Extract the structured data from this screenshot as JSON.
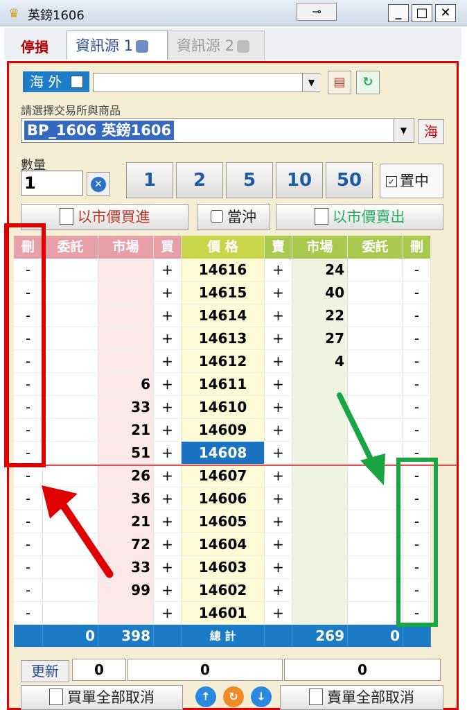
{
  "window": {
    "title": "英鎊1606",
    "min_glyph": "_",
    "max_glyph": "□",
    "close_glyph": "✕",
    "pin_glyph": "⊸"
  },
  "tabs": {
    "stop_loss": "停損",
    "source1": "資訊源 1",
    "source2": "資訊源 2"
  },
  "top": {
    "overseas_label": "海 外",
    "exchange_label": "請選擇交易所與商品",
    "exchange_value": "BP_1606 英鎊1606",
    "hai_button": "海"
  },
  "quantity": {
    "label": "數量",
    "value": "1",
    "presets": [
      "1",
      "2",
      "5",
      "10",
      "50"
    ],
    "center_label": "置中",
    "center_checked": true
  },
  "orders": {
    "buy_market": "以市價買進",
    "day_trade": "當沖",
    "sell_market": "以市價賣出"
  },
  "book": {
    "headers": [
      "刪",
      "委託",
      "市場",
      "買",
      "價 格",
      "賣",
      "市場",
      "委託",
      "刪"
    ],
    "current_price": "14608",
    "rows": [
      {
        "del_l": "-",
        "buy_order": "",
        "buy_mkt": "",
        "buy": "+",
        "price": "14616",
        "sell": "+",
        "sell_mkt": "24",
        "sell_order": "",
        "del_r": "-"
      },
      {
        "del_l": "-",
        "buy_order": "",
        "buy_mkt": "",
        "buy": "+",
        "price": "14615",
        "sell": "+",
        "sell_mkt": "40",
        "sell_order": "",
        "del_r": "-"
      },
      {
        "del_l": "-",
        "buy_order": "",
        "buy_mkt": "",
        "buy": "+",
        "price": "14614",
        "sell": "+",
        "sell_mkt": "22",
        "sell_order": "",
        "del_r": "-"
      },
      {
        "del_l": "-",
        "buy_order": "",
        "buy_mkt": "",
        "buy": "+",
        "price": "14613",
        "sell": "+",
        "sell_mkt": "27",
        "sell_order": "",
        "del_r": "-"
      },
      {
        "del_l": "-",
        "buy_order": "",
        "buy_mkt": "",
        "buy": "+",
        "price": "14612",
        "sell": "+",
        "sell_mkt": "4",
        "sell_order": "",
        "del_r": "-"
      },
      {
        "del_l": "-",
        "buy_order": "",
        "buy_mkt": "6",
        "buy": "+",
        "price": "14611",
        "sell": "+",
        "sell_mkt": "",
        "sell_order": "",
        "del_r": "-"
      },
      {
        "del_l": "-",
        "buy_order": "",
        "buy_mkt": "33",
        "buy": "+",
        "price": "14610",
        "sell": "+",
        "sell_mkt": "",
        "sell_order": "",
        "del_r": "-"
      },
      {
        "del_l": "-",
        "buy_order": "",
        "buy_mkt": "21",
        "buy": "+",
        "price": "14609",
        "sell": "+",
        "sell_mkt": "",
        "sell_order": "",
        "del_r": "-"
      },
      {
        "del_l": "-",
        "buy_order": "",
        "buy_mkt": "51",
        "buy": "+",
        "price": "14608",
        "sell": "+",
        "sell_mkt": "",
        "sell_order": "",
        "del_r": "-"
      },
      {
        "del_l": "-",
        "buy_order": "",
        "buy_mkt": "26",
        "buy": "+",
        "price": "14607",
        "sell": "+",
        "sell_mkt": "",
        "sell_order": "",
        "del_r": "-"
      },
      {
        "del_l": "-",
        "buy_order": "",
        "buy_mkt": "36",
        "buy": "+",
        "price": "14606",
        "sell": "+",
        "sell_mkt": "",
        "sell_order": "",
        "del_r": "-"
      },
      {
        "del_l": "-",
        "buy_order": "",
        "buy_mkt": "21",
        "buy": "+",
        "price": "14605",
        "sell": "+",
        "sell_mkt": "",
        "sell_order": "",
        "del_r": "-"
      },
      {
        "del_l": "-",
        "buy_order": "",
        "buy_mkt": "72",
        "buy": "+",
        "price": "14604",
        "sell": "+",
        "sell_mkt": "",
        "sell_order": "",
        "del_r": "-"
      },
      {
        "del_l": "-",
        "buy_order": "",
        "buy_mkt": "33",
        "buy": "+",
        "price": "14603",
        "sell": "+",
        "sell_mkt": "",
        "sell_order": "",
        "del_r": "-"
      },
      {
        "del_l": "-",
        "buy_order": "",
        "buy_mkt": "99",
        "buy": "+",
        "price": "14602",
        "sell": "+",
        "sell_mkt": "",
        "sell_order": "",
        "del_r": "-"
      },
      {
        "del_l": "-",
        "buy_order": "",
        "buy_mkt": "",
        "buy": "+",
        "price": "14601",
        "sell": "+",
        "sell_mkt": "",
        "sell_order": "",
        "del_r": "-"
      }
    ],
    "totals": {
      "buy_order": "0",
      "buy_mkt": "398",
      "label": "總 計",
      "sell_mkt": "269",
      "sell_order": "0"
    }
  },
  "footer": {
    "update_label": "更新",
    "values": [
      "0",
      "0",
      "0"
    ],
    "cancel_buy_all": "買單全部取消",
    "cancel_sell_all": "賣單全部取消"
  },
  "colors": {
    "frame": "#e00000",
    "buy_header": "#e8a0a8",
    "sell_header": "#a8c84e",
    "current_price": "#1a73c2",
    "totals": "#1b7bc4",
    "annotation_red": "#e00000",
    "annotation_green": "#1aa543"
  }
}
